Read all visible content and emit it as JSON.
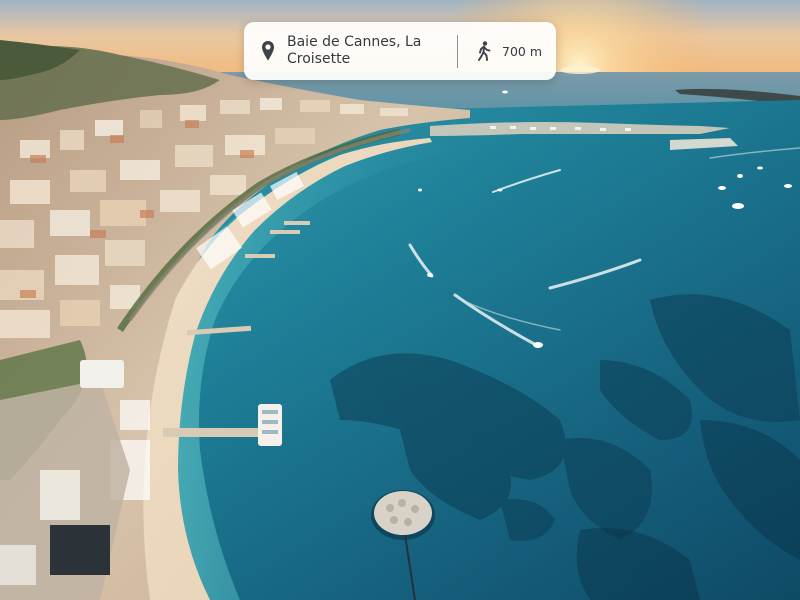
{
  "location_card": {
    "place_name": "Baie de Cannes, La Croisette",
    "distance": "700 m",
    "pin_icon": "map-pin-icon",
    "walk_icon": "walking-person-icon"
  },
  "colors": {
    "card_background": "#ffffff",
    "card_text": "#333a40",
    "sea_deep": "#0f4f6b",
    "sea_shallow": "#2aa0b0",
    "sky_warm": "#f4b36b"
  }
}
